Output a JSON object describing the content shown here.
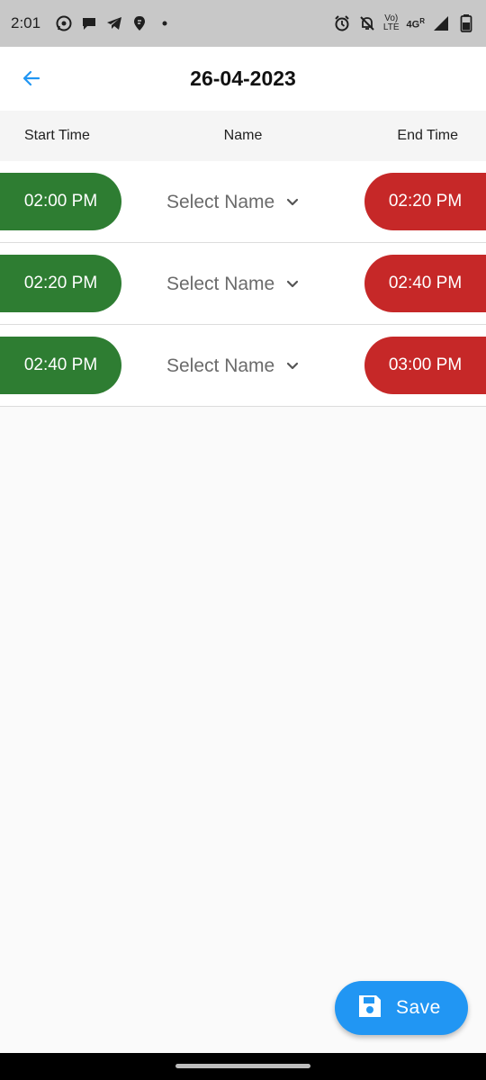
{
  "status_bar": {
    "time": "2:01",
    "network_label_top": "Vo)",
    "network_label_bottom": "LTE",
    "signal_label": "4G",
    "signal_sup": "R"
  },
  "app_bar": {
    "title": "26-04-2023",
    "back_icon": "arrow-left-icon",
    "accent": "#2196f3"
  },
  "table": {
    "headers": {
      "start": "Start Time",
      "name": "Name",
      "end": "End Time"
    },
    "rows": [
      {
        "start": "02:00 PM",
        "name": "Select Name",
        "end": "02:20 PM"
      },
      {
        "start": "02:20 PM",
        "name": "Select Name",
        "end": "02:40 PM"
      },
      {
        "start": "02:40 PM",
        "name": "Select Name",
        "end": "03:00 PM"
      }
    ],
    "colors": {
      "start": "#2e7d32",
      "end": "#c62828"
    }
  },
  "fab": {
    "label": "Save",
    "icon": "save-icon",
    "color": "#2196f3"
  }
}
